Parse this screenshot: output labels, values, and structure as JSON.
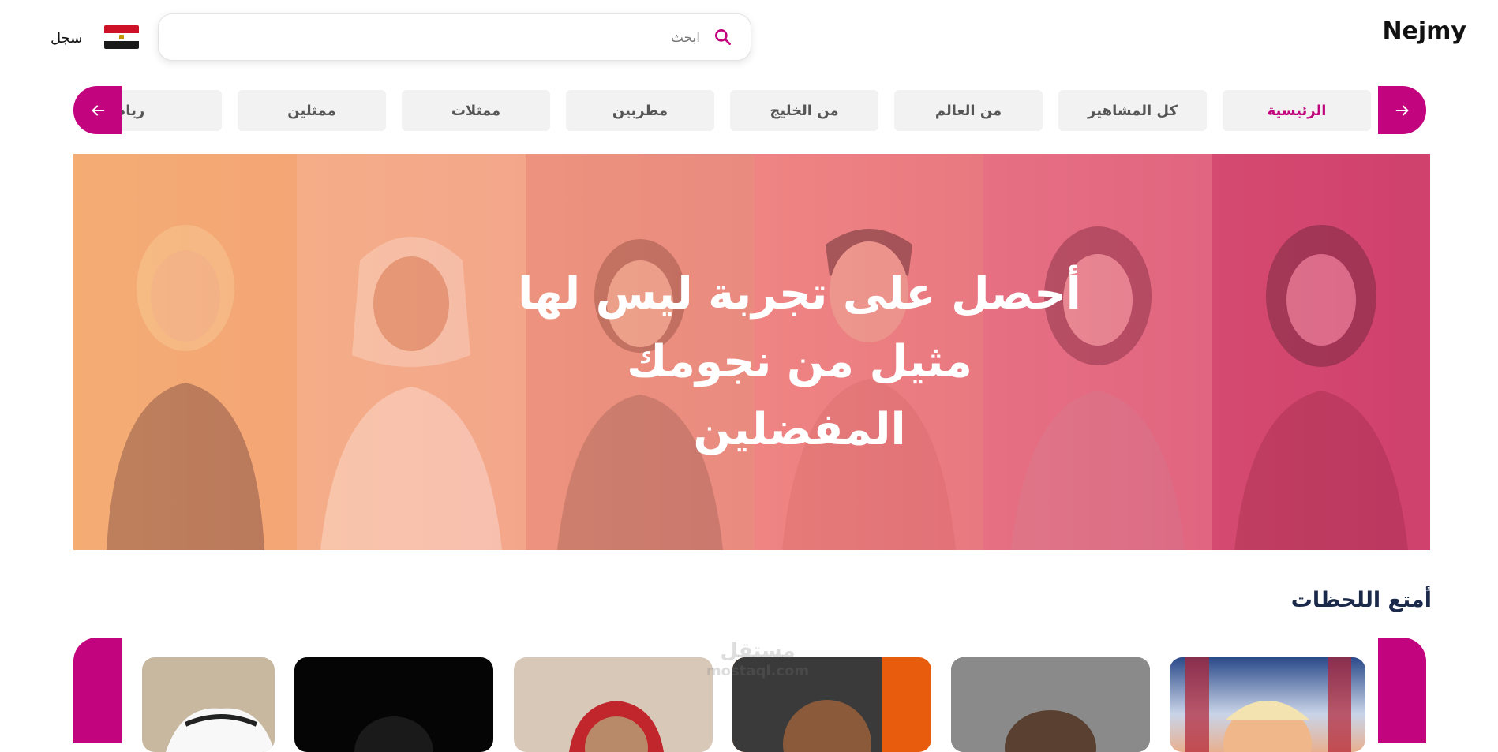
{
  "header": {
    "brand": "Nejmy",
    "search_placeholder": "ابحث",
    "register_label": "سجل",
    "flag_colors": [
      "#ce1126",
      "#ffffff",
      "#000000"
    ]
  },
  "nav": {
    "categories": [
      {
        "label": "الرئيسية",
        "active": true
      },
      {
        "label": "كل المشاهير",
        "active": false
      },
      {
        "label": "من العالم",
        "active": false
      },
      {
        "label": "من الخليج",
        "active": false
      },
      {
        "label": "مطربين",
        "active": false
      },
      {
        "label": "ممثلات",
        "active": false
      },
      {
        "label": "ممثلين",
        "active": false
      },
      {
        "label": "رياضة",
        "active": false
      }
    ],
    "accent_color": "#c2047e"
  },
  "hero": {
    "title": "أحصل على تجربة ليس لها مثيل من نجومك المفضلين"
  },
  "moments": {
    "title": "أمتع اللحظات"
  },
  "watermark": {
    "text": "مستقل",
    "subtext": "mostaql.com"
  }
}
